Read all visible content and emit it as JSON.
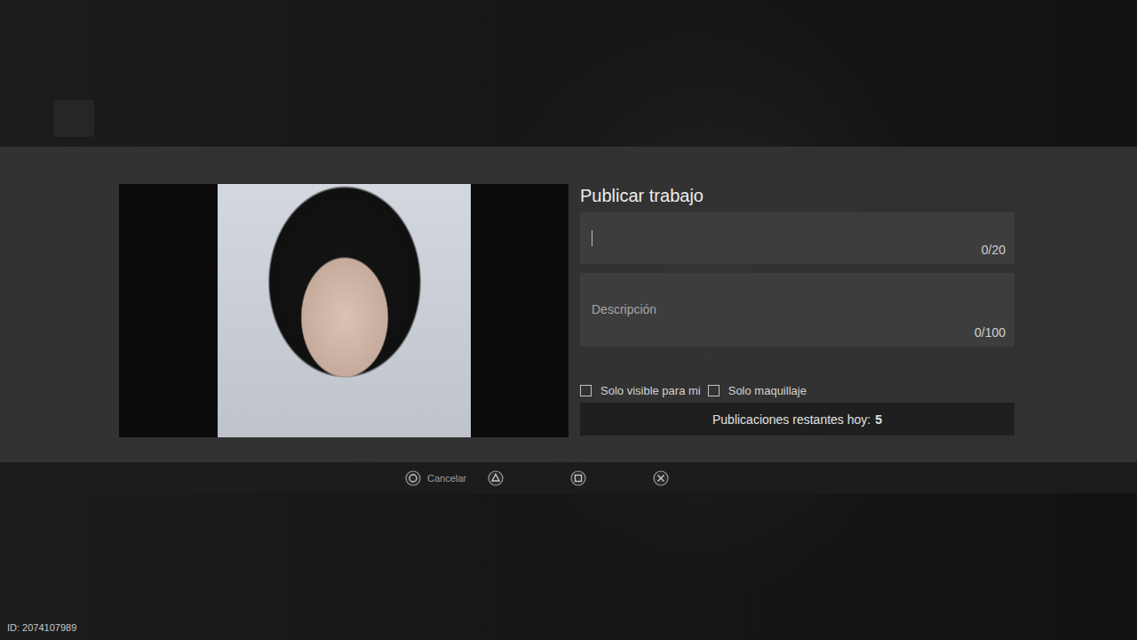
{
  "dialog": {
    "title": "Publicar trabajo"
  },
  "fields": [
    {
      "placeholder": "",
      "counter": "0/20",
      "focused": true
    },
    {
      "placeholder": "Descripción",
      "counter": "0/100",
      "focused": false
    }
  ],
  "checkboxes": [
    {
      "label": "Solo visible para mi",
      "checked": false
    },
    {
      "label": "Solo maquillaje",
      "checked": false
    }
  ],
  "remaining": {
    "label": "Publicaciones restantes hoy:",
    "count": "5"
  },
  "buttons": [
    {
      "kind": "circle",
      "label": "Cancelar"
    },
    {
      "kind": "triangle",
      "label": ""
    },
    {
      "kind": "square",
      "label": ""
    },
    {
      "kind": "cross",
      "label": ""
    }
  ],
  "footer": {
    "id": "ID: 2074107989"
  }
}
